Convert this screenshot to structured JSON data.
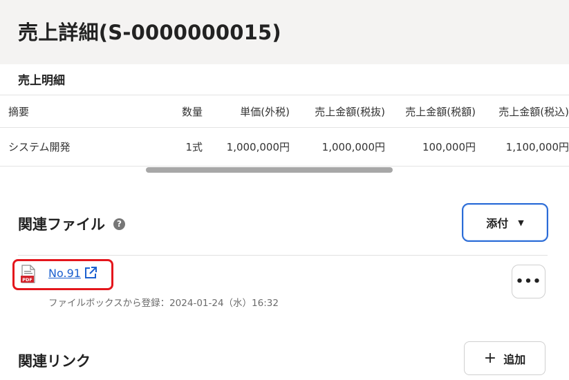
{
  "page": {
    "title": "売上詳細(S-0000000015)"
  },
  "sales_details": {
    "section_title": "売上明細",
    "columns": [
      "摘要",
      "数量",
      "単価(外税)",
      "売上金額(税抜)",
      "売上金額(税額)",
      "売上金額(税込)"
    ],
    "rows": [
      [
        "システム開発",
        "1式",
        "1,000,000円",
        "1,000,000円",
        "100,000円",
        "1,100,000円"
      ]
    ]
  },
  "related_files": {
    "title": "関連ファイル",
    "help_icon": "question-circle-icon",
    "attach_button": "添付",
    "items": [
      {
        "file_type_icon": "pdf-file-icon",
        "name": "No.91",
        "link_icon": "external-link-icon",
        "meta": "ファイルボックスから登録：2024-01-24（水）16:32",
        "more_label": "•••"
      }
    ]
  },
  "related_links": {
    "title": "関連リンク",
    "add_button": "追加",
    "add_icon": "plus-icon"
  },
  "colors": {
    "accent": "#2a6bd6",
    "link": "#1a5fcf",
    "highlight": "#e4161c",
    "pdf_red": "#d3222a",
    "header_bg": "#f4f3f2"
  }
}
